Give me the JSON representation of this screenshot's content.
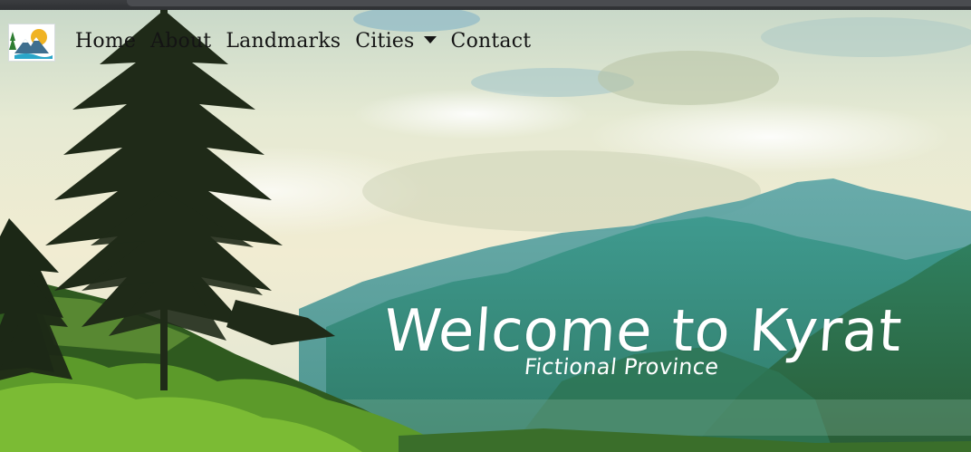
{
  "nav": {
    "logo_alt": "Kyrat logo",
    "links": [
      {
        "label": "Home"
      },
      {
        "label": "About"
      },
      {
        "label": "Landmarks"
      },
      {
        "label": "Cities"
      },
      {
        "label": "Contact"
      }
    ]
  },
  "hero": {
    "title": "Welcome to Kyrat",
    "subtitle": "Fictional Province"
  },
  "colors": {
    "sky": "#e8ecd6",
    "mountain": "#3c8f8e",
    "forest": "#2f5a1f",
    "nav_text": "#141414",
    "title_text": "#ffffff"
  }
}
